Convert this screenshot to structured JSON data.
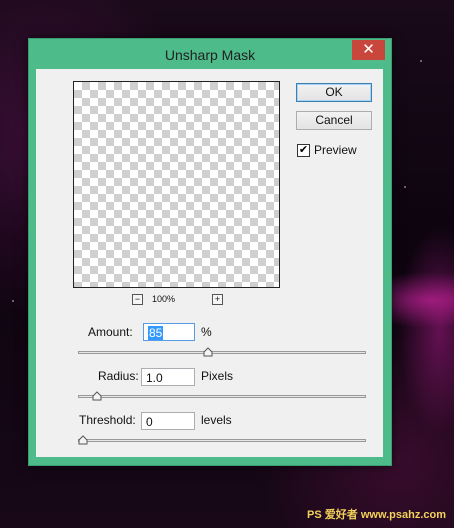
{
  "dialog": {
    "title": "Unsharp Mask",
    "close_glyph": "✕"
  },
  "buttons": {
    "ok": "OK",
    "cancel": "Cancel"
  },
  "preview": {
    "label": "Preview",
    "checked": true,
    "check_glyph": "✔"
  },
  "zoom": {
    "minus": "−",
    "plus": "+",
    "level": "100%"
  },
  "amount": {
    "label": "Amount:",
    "value": "85",
    "unit": "%",
    "slider_fraction": 0.45
  },
  "radius": {
    "label": "Radius:",
    "value": "1.0",
    "unit": "Pixels",
    "slider_fraction": 0.05
  },
  "threshold": {
    "label": "Threshold:",
    "value": "0",
    "unit": "levels",
    "slider_fraction": 0.0
  },
  "watermark": {
    "text": "PS 爱好者  www.psahz.com"
  },
  "colors": {
    "titlebar": "#4dbb8a",
    "close": "#c9463d",
    "selection": "#3399ff"
  }
}
